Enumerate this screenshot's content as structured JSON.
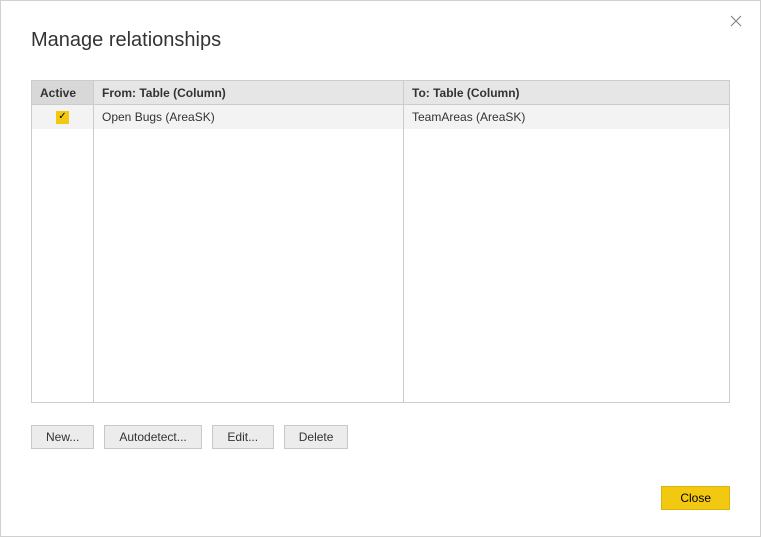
{
  "dialog": {
    "title": "Manage relationships"
  },
  "table": {
    "headers": {
      "active": "Active",
      "from": "From: Table (Column)",
      "to": "To: Table (Column)"
    },
    "rows": [
      {
        "active": true,
        "from": "Open Bugs (AreaSK)",
        "to": "TeamAreas (AreaSK)"
      }
    ]
  },
  "buttons": {
    "new": "New...",
    "autodetect": "Autodetect...",
    "edit": "Edit...",
    "delete": "Delete",
    "close": "Close"
  }
}
